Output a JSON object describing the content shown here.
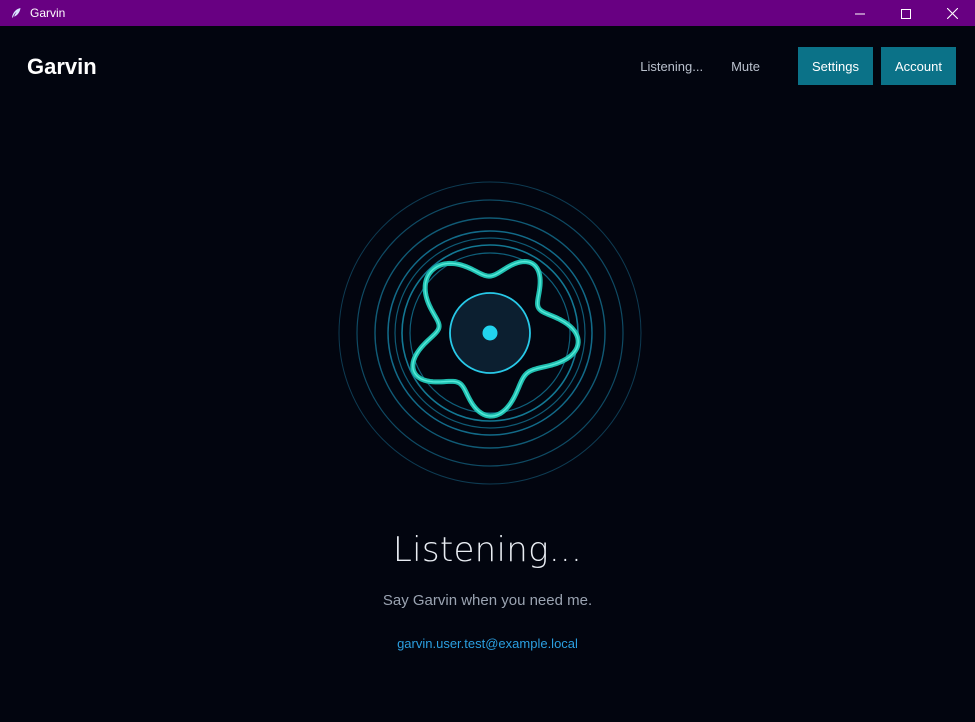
{
  "window": {
    "title": "Garvin",
    "controls": {
      "minimize_icon": "minimize-icon",
      "maximize_icon": "maximize-icon",
      "close_icon": "close-icon"
    },
    "titlebar_color": "#680082"
  },
  "header": {
    "brand": "Garvin",
    "status_link": "Listening...",
    "mute_link": "Mute",
    "settings_button": "Settings",
    "account_button": "Account",
    "button_color": "#0b7288"
  },
  "main": {
    "status": "Listening...",
    "hint": "Say Garvin when you need me.",
    "email": "garvin.user.test@example.local"
  },
  "visualizer": {
    "accent": "#22d3ee",
    "wave": "#1fbfb0",
    "icon": "voice-orb-icon"
  }
}
